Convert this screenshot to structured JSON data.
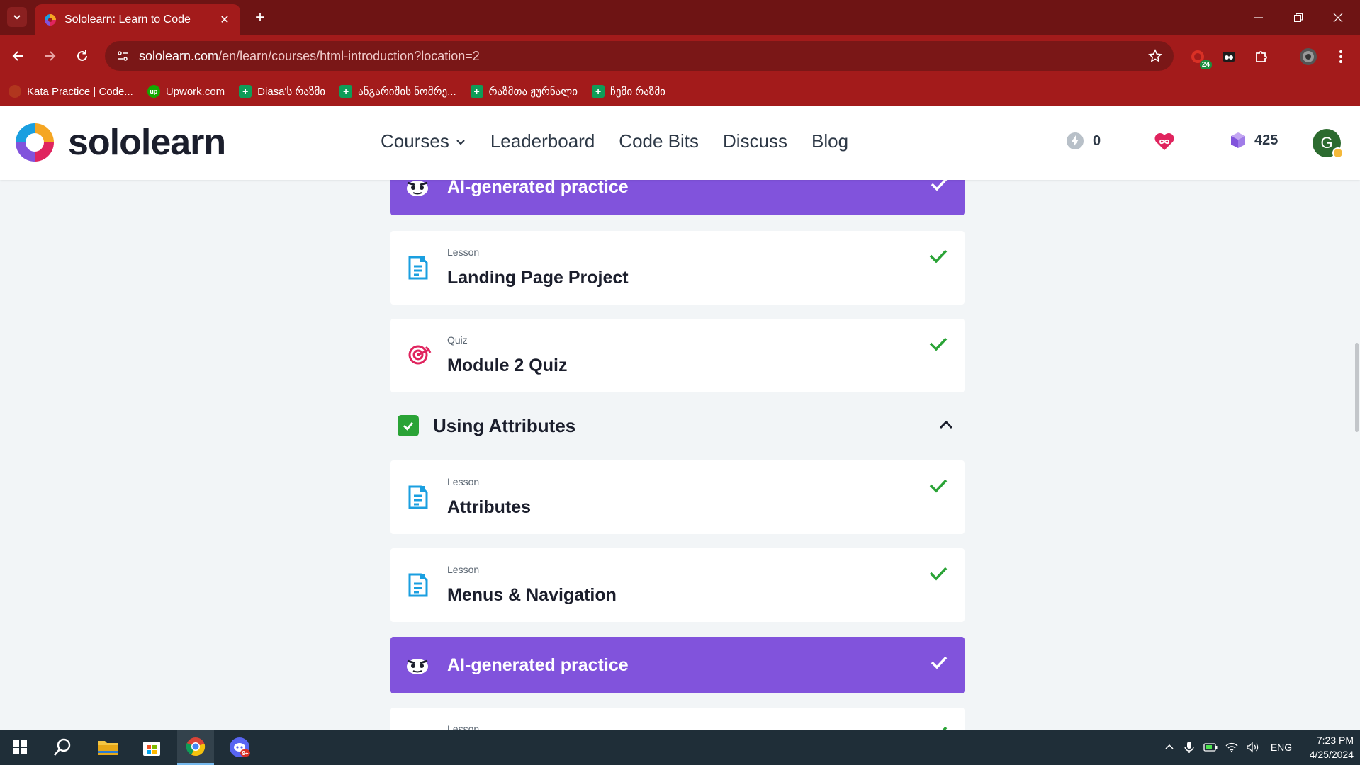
{
  "browser": {
    "tab": {
      "title": "Sololearn: Learn to Code"
    },
    "url": {
      "host": "sololearn.com",
      "path": "/en/learn/courses/html-introduction?location=2"
    },
    "extension_badge": "24",
    "bookmarks": [
      {
        "label": "Kata Practice | Code...",
        "icon": "codewars-icon",
        "color": "#b1361e"
      },
      {
        "label": "Upwork.com",
        "icon": "upwork-icon",
        "color": "#14a800"
      },
      {
        "label": "Diasa'ს რაზმი",
        "icon": "plus-flag-icon",
        "color": "#0f9d58"
      },
      {
        "label": "ანგარიშის ნომრე...",
        "icon": "plus-flag-icon",
        "color": "#0f9d58"
      },
      {
        "label": "რაზმთა ჟურნალი",
        "icon": "plus-flag-icon",
        "color": "#0f9d58"
      },
      {
        "label": "ჩემი რაზმი",
        "icon": "plus-flag-icon",
        "color": "#0f9d58"
      }
    ]
  },
  "header": {
    "logo_text": "sololearn",
    "nav": [
      {
        "label": "Courses",
        "has_dropdown": true
      },
      {
        "label": "Leaderboard"
      },
      {
        "label": "Code Bits"
      },
      {
        "label": "Discuss"
      },
      {
        "label": "Blog"
      }
    ],
    "streak": "0",
    "bits": "425",
    "avatar_initial": "G"
  },
  "course": {
    "items": [
      {
        "kind": "ai",
        "title": "AI-generated practice",
        "completed": true
      },
      {
        "kind": "lesson",
        "type_label": "Lesson",
        "title": "Landing Page Project",
        "completed": true
      },
      {
        "kind": "quiz",
        "type_label": "Quiz",
        "title": "Module 2 Quiz",
        "completed": true
      },
      {
        "kind": "section",
        "title": "Using Attributes",
        "completed": true,
        "expanded": true
      },
      {
        "kind": "lesson",
        "type_label": "Lesson",
        "title": "Attributes",
        "completed": true
      },
      {
        "kind": "lesson",
        "type_label": "Lesson",
        "title": "Menus & Navigation",
        "completed": true
      },
      {
        "kind": "ai",
        "title": "AI-generated practice",
        "completed": true
      },
      {
        "kind": "lesson",
        "type_label": "Lesson",
        "title": "",
        "completed": true
      }
    ]
  },
  "taskbar": {
    "language": "ENG",
    "time": "7:23 PM",
    "date": "4/25/2024",
    "app_badge": "9+"
  },
  "colors": {
    "chrome_dark": "#6e1414",
    "chrome": "#a31b1b",
    "accent_purple": "#8153dc",
    "check_green": "#2aa336",
    "lesson_blue": "#1a9fe0",
    "quiz_pink": "#e0245e",
    "page_bg": "#f2f5f7"
  }
}
